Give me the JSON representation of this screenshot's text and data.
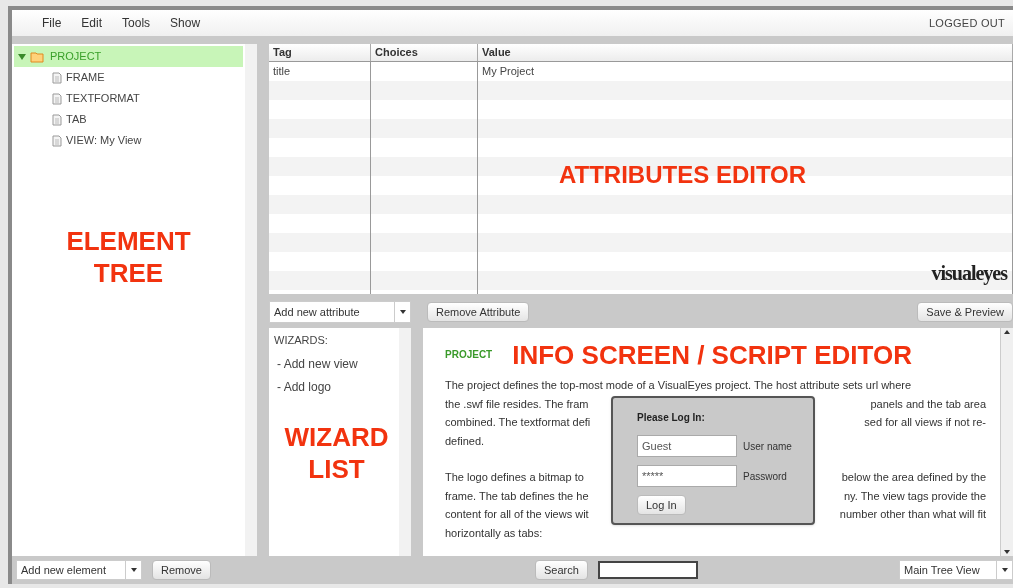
{
  "menu": [
    "File",
    "Edit",
    "Tools",
    "Show"
  ],
  "login_status": "LOGGED OUT",
  "tree": [
    {
      "label": "PROJECT",
      "selected": true,
      "expanded": true,
      "children": [
        {
          "label": "FRAME",
          "selected": false
        },
        {
          "label": "TEXTFORMAT",
          "selected": false
        },
        {
          "label": "TAB",
          "selected": false
        },
        {
          "label": "VIEW: My View",
          "selected": false
        }
      ]
    }
  ],
  "tree_annotation": [
    "ELEMENT",
    "TREE"
  ],
  "attributes": {
    "columns": [
      "Tag",
      "Choices",
      "Value"
    ],
    "rows": [
      [
        "title",
        "",
        "My Project"
      ]
    ],
    "annotation": "ATTRIBUTES EDITOR",
    "logo": "visualeyes"
  },
  "attribute_toolbar": {
    "add_select": "Add new attribute",
    "remove_button": "Remove Attribute",
    "save_button": "Save & Preview"
  },
  "wizards": {
    "heading": "WIZARDS:",
    "items": [
      "- Add new view",
      "- Add logo"
    ],
    "annotation": [
      "WIZARD",
      "LIST"
    ]
  },
  "info": {
    "heading": "PROJECT",
    "annotation": "INFO SCREEN / SCRIPT EDITOR",
    "paragraphs": [
      [
        [
          "The project defines the top-most mode of a VisualEyes project. The host attribute sets url where"
        ],
        [
          "the .swf file resides. The fram",
          "panels and the tab area"
        ],
        [
          "combined. The textformat defi",
          "sed for all views if not re-"
        ],
        [
          "defined."
        ]
      ],
      [
        [
          "The logo defines a bitmap to",
          "below the area defined by the"
        ],
        [
          "frame. The tab defines the he",
          "ny. The view tags provide the"
        ],
        [
          "content for all of the views wit",
          "number other than what will fit"
        ],
        [
          "horizontally as tabs:"
        ]
      ]
    ]
  },
  "login_dialog": {
    "title": "Please Log In:",
    "username": "Guest",
    "username_label": "User name",
    "password": "*****",
    "password_label": "Password",
    "button": "Log In"
  },
  "bottom_bar": {
    "add_select": "Add new element",
    "remove_button": "Remove",
    "search_button": "Search",
    "view_select": "Main Tree View"
  }
}
